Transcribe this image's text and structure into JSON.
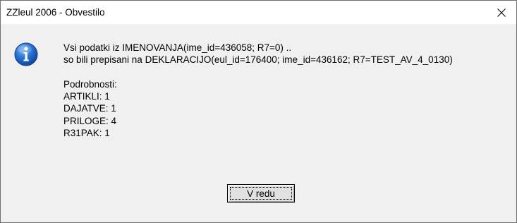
{
  "window": {
    "title": "ZZleul 2006 - Obvestilo"
  },
  "icons": {
    "message_icon": "info-icon",
    "close_icon": "close-icon"
  },
  "message": {
    "line1": "Vsi podatki iz IMENOVANJA(ime_id=436058; R7=0) ..",
    "line2": "so bili prepisani na DEKLARACIJO(eul_id=176400; ime_id=436162; R7=TEST_AV_4_0130)",
    "details_heading": "Podrobnosti:",
    "details": [
      "ARTIKLI: 1",
      "DAJATVE: 1",
      "PRILOGE: 4",
      "R31PAK: 1"
    ]
  },
  "buttons": {
    "ok_label": "V redu"
  },
  "colors": {
    "client_background": "#f0f0f0",
    "title_background": "#ffffff",
    "icon_blue": "#1c62c4"
  }
}
